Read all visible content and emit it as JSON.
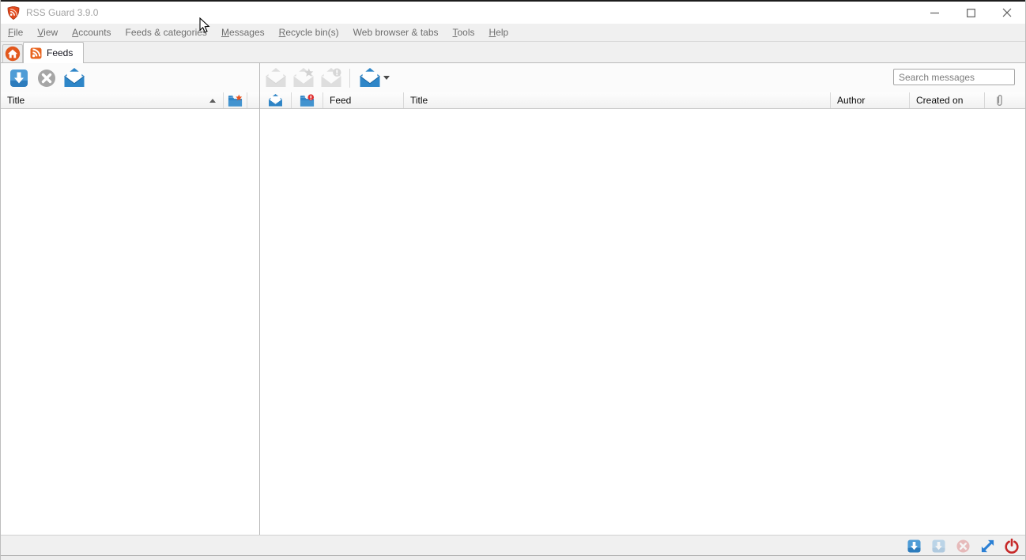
{
  "window": {
    "title": "RSS Guard 3.9.0",
    "controls": {
      "minimize": "minimize",
      "maximize": "maximize",
      "close": "close"
    }
  },
  "menu": {
    "items": [
      {
        "accel": "F",
        "rest": "ile"
      },
      {
        "accel": "V",
        "rest": "iew"
      },
      {
        "accel": "A",
        "rest": "ccounts"
      },
      {
        "accel": "",
        "rest": "Feeds & categories"
      },
      {
        "accel": "M",
        "rest": "essages"
      },
      {
        "accel": "R",
        "rest": "ecycle bin(s)"
      },
      {
        "accel": "",
        "rest": "Web browser & tabs"
      },
      {
        "accel": "T",
        "rest": "ools"
      },
      {
        "accel": "H",
        "rest": "elp"
      }
    ]
  },
  "tabs": {
    "home_icon": "home-icon",
    "active_tab": {
      "icon": "rss-feed-icon",
      "label": "Feeds"
    }
  },
  "toolbar": {
    "feeds_buttons": [
      "update-feeds-icon",
      "stop-update-icon",
      "mark-feed-read-icon"
    ],
    "message_buttons": [
      "mark-read-icon",
      "mark-important-icon",
      "mark-unread-icon",
      "mark-all-read-dropdown-icon"
    ],
    "search": {
      "placeholder": "Search messages"
    }
  },
  "feeds_panel": {
    "columns": {
      "title": "Title",
      "counts_icon": "folder-star-icon"
    },
    "sort": "ascending",
    "rows": []
  },
  "messages_panel": {
    "columns": {
      "read_icon": "envelope-icon",
      "importance_icon": "folder-alert-icon",
      "feed": "Feed",
      "title": "Title",
      "author": "Author",
      "created_on": "Created on",
      "attachment_icon": "paperclip-icon"
    },
    "rows": []
  },
  "statusbar": {
    "buttons": [
      "update-feeds-icon",
      "update-selected-feeds-icon",
      "stop-update-icon",
      "fullscreen-icon",
      "quit-icon"
    ]
  },
  "colors": {
    "accent_blue": "#2e86c8",
    "accent_orange": "#e8611c",
    "power_red": "#c62828",
    "disabled_gray": "#a6a6a6",
    "chrome_gray": "#f0f0f0"
  }
}
